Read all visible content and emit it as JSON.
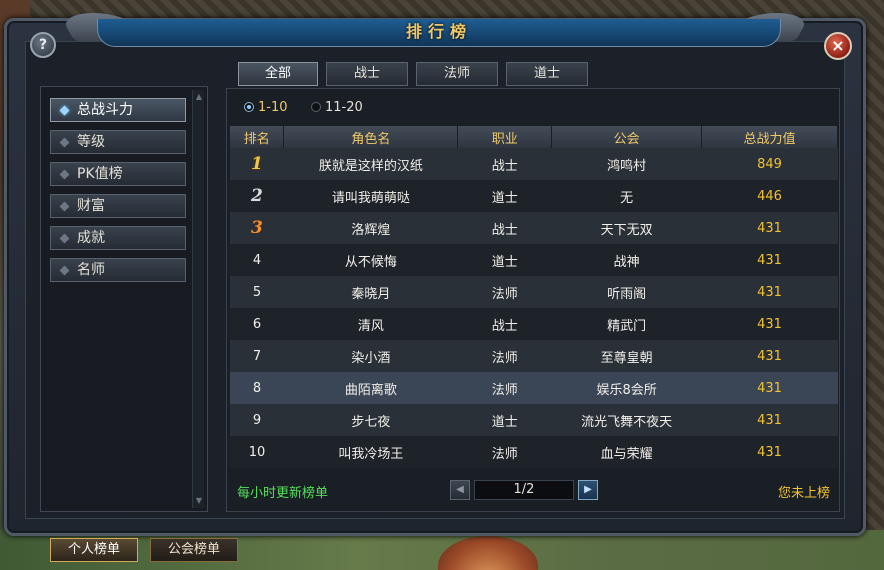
{
  "window": {
    "title": "排行榜"
  },
  "buttons": {
    "help_label": "?",
    "close_label": "×"
  },
  "tabs": [
    {
      "label": "全部",
      "active": true
    },
    {
      "label": "战士",
      "active": false
    },
    {
      "label": "法师",
      "active": false
    },
    {
      "label": "道士",
      "active": false
    }
  ],
  "categories": [
    {
      "label": "总战斗力",
      "active": true
    },
    {
      "label": "等级",
      "active": false
    },
    {
      "label": "PK值榜",
      "active": false
    },
    {
      "label": "财富",
      "active": false
    },
    {
      "label": "成就",
      "active": false
    },
    {
      "label": "名师",
      "active": false
    }
  ],
  "range": [
    {
      "label": "1-10",
      "selected": true
    },
    {
      "label": "11-20",
      "selected": false
    }
  ],
  "table": {
    "headers": [
      "排名",
      "角色名",
      "职业",
      "公会",
      "总战力值"
    ],
    "rows": [
      {
        "rank": "1",
        "name": "朕就是这样的汉纸",
        "job": "战士",
        "guild": "鸿鸣村",
        "power": "849"
      },
      {
        "rank": "2",
        "name": "请叫我萌萌哒",
        "job": "道士",
        "guild": "无",
        "power": "446"
      },
      {
        "rank": "3",
        "name": "洛辉煌",
        "job": "战士",
        "guild": "天下无双",
        "power": "431"
      },
      {
        "rank": "4",
        "name": "从不候悔",
        "job": "道士",
        "guild": "战神",
        "power": "431"
      },
      {
        "rank": "5",
        "name": "秦晓月",
        "job": "法师",
        "guild": "听雨阁",
        "power": "431"
      },
      {
        "rank": "6",
        "name": "清风",
        "job": "战士",
        "guild": "精武门",
        "power": "431"
      },
      {
        "rank": "7",
        "name": "染小酒",
        "job": "法师",
        "guild": "至尊皇朝",
        "power": "431"
      },
      {
        "rank": "8",
        "name": "曲陌离歌",
        "job": "法师",
        "guild": "娱乐8会所",
        "power": "431"
      },
      {
        "rank": "9",
        "name": "步七夜",
        "job": "道士",
        "guild": "流光飞舞不夜天",
        "power": "431"
      },
      {
        "rank": "10",
        "name": "叫我冷场王",
        "job": "法师",
        "guild": "血与荣耀",
        "power": "431"
      }
    ]
  },
  "footer": {
    "update_note": "每小时更新榜单",
    "page": "1/2",
    "my_rank": "您未上榜"
  },
  "bottom_tabs": [
    {
      "label": "个人榜单",
      "active": true
    },
    {
      "label": "公会榜单",
      "active": false
    }
  ],
  "colors": {
    "gold": "#f2c230",
    "green": "#55e05a",
    "title": "#f0c86a"
  }
}
